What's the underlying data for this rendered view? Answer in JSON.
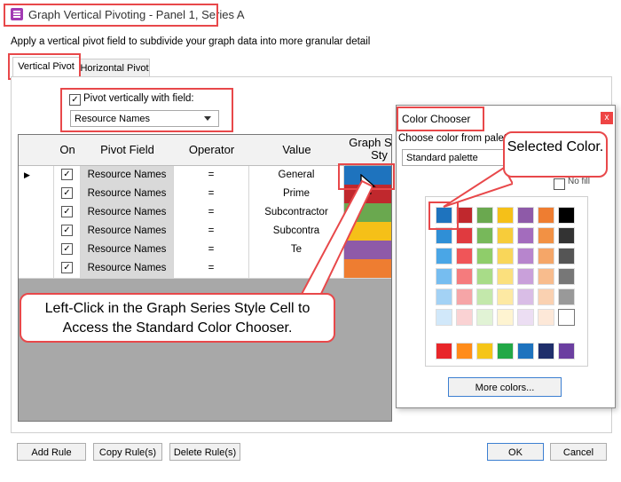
{
  "window": {
    "title": "Graph Vertical Pivoting - Panel 1, Series A"
  },
  "subtitle": "Apply a vertical pivot field to subdivide your graph data into more granular detail",
  "tabs": [
    {
      "label": "Vertical Pivot"
    },
    {
      "label": "Horizontal Pivot"
    }
  ],
  "pivot": {
    "checkbox_label": "Pivot vertically with field:",
    "field_value": "Resource Names"
  },
  "grid": {
    "headers": [
      "On",
      "Pivot Field",
      "Operator",
      "Value",
      "Graph Series Style"
    ],
    "header_visible_text": "Graph S",
    "header_visible_text2": "Sty",
    "rows": [
      {
        "field": "Resource Names",
        "operator": "=",
        "value": "General",
        "color": "#1e73be"
      },
      {
        "field": "Resource Names",
        "operator": "=",
        "value": "Prime",
        "color": "#c0282d"
      },
      {
        "field": "Resource Names",
        "operator": "=",
        "value": "Subcontractor",
        "color": "#6aa84f"
      },
      {
        "field": "Resource Names",
        "operator": "=",
        "value": "Subcontra",
        "color": "#f5c018"
      },
      {
        "field": "Resource Names",
        "operator": "=",
        "value": "Te",
        "color": "#8e5aa8"
      },
      {
        "field": "Resource Names",
        "operator": "=",
        "value": "",
        "color": "#ee7d31"
      }
    ]
  },
  "buttons": {
    "add_rule": "Add Rule",
    "copy_rules": "Copy Rule(s)",
    "delete_rules": "Delete Rule(s)",
    "ok": "OK",
    "cancel": "Cancel"
  },
  "color_chooser": {
    "title": "Color Chooser",
    "prompt": "Choose color from palet",
    "palette_value": "Standard palette",
    "no_fill": "No fill",
    "more_colors": "More colors...",
    "close": "x",
    "palette": [
      [
        "#1e73be",
        "#c0282d",
        "#6aa84f",
        "#f5c018",
        "#8e5aa8",
        "#ee7d31",
        "#000000"
      ],
      [
        "#2f8fd6",
        "#e03a3f",
        "#77b85a",
        "#f7cc3a",
        "#a36cbd",
        "#f29144",
        "#333333"
      ],
      [
        "#4aa6e6",
        "#f05558",
        "#8fcd6a",
        "#f9d659",
        "#b785cd",
        "#f5a668",
        "#555555"
      ],
      [
        "#76bdf0",
        "#f57b7d",
        "#a8dc88",
        "#fbe07d",
        "#c9a0da",
        "#f8bc8d",
        "#777777"
      ],
      [
        "#a3d2f5",
        "#f6a5a7",
        "#c3e8ab",
        "#fde9a3",
        "#d9bde6",
        "#fad1b1",
        "#999999"
      ],
      [
        "#d1e8fa",
        "#fad2d3",
        "#e1f3d5",
        "#fef4d1",
        "#ecdef3",
        "#fde8d8",
        "#ffffff"
      ],
      [
        "#e8262a",
        "#ff8c1a",
        "#f5c518",
        "#23a847",
        "#1e73be",
        "#1f2f6b",
        "#6b3fa0"
      ]
    ]
  },
  "callouts": {
    "selected": "Selected Color.",
    "instruction": "Left-Click in the Graph Series Style Cell to Access the Standard Color Chooser."
  }
}
